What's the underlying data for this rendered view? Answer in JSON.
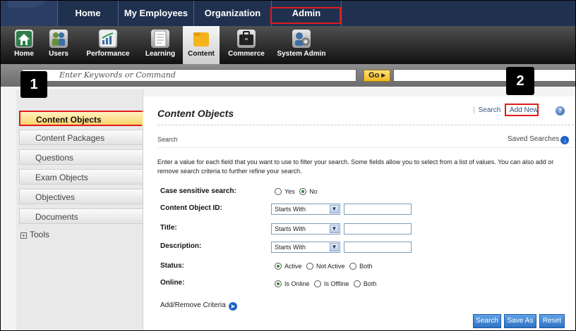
{
  "top_nav": {
    "items": [
      {
        "label": "Home"
      },
      {
        "label": "My Employees"
      },
      {
        "label": "Organization"
      },
      {
        "label": "Admin"
      }
    ]
  },
  "icon_bar": {
    "items": [
      {
        "label": "Home",
        "icon": "house-icon"
      },
      {
        "label": "Users",
        "icon": "users-icon"
      },
      {
        "label": "Performance",
        "icon": "chart-icon"
      },
      {
        "label": "Learning",
        "icon": "document-icon"
      },
      {
        "label": "Content",
        "icon": "folder-icon"
      },
      {
        "label": "Commerce",
        "icon": "briefcase-icon"
      },
      {
        "label": "System Admin",
        "icon": "admin-gear-icon"
      }
    ],
    "active": "Content"
  },
  "search_bar": {
    "placeholder": "Enter Keywords or Command",
    "go_label": "Go ▸"
  },
  "badges": {
    "one": "1",
    "two": "2"
  },
  "sidebar": {
    "items": [
      {
        "label": "Content Objects"
      },
      {
        "label": "Content Packages"
      },
      {
        "label": "Questions"
      },
      {
        "label": "Exam Objects"
      },
      {
        "label": "Objectives"
      },
      {
        "label": "Documents"
      }
    ],
    "tools_label": "Tools",
    "active": "Content Objects"
  },
  "main": {
    "title": "Content Objects",
    "links": {
      "search": "Search",
      "add_new": "Add New"
    },
    "help_label": "?",
    "section_label": "Search",
    "saved_searches": "Saved Searches",
    "intro": "Enter a value for each field that you want to use to filter your search. Some fields allow you to select from a list of values. You can also add or remove search criteria to further refine your search.",
    "fields": {
      "case_sensitive": {
        "label": "Case sensitive search:",
        "options": [
          "Yes",
          "No"
        ],
        "selected": "No"
      },
      "content_object_id": {
        "label": "Content Object ID:",
        "operator": "Starts With",
        "value": ""
      },
      "title": {
        "label": "Title:",
        "operator": "Starts With",
        "value": ""
      },
      "description": {
        "label": "Description:",
        "operator": "Starts With",
        "value": ""
      },
      "status": {
        "label": "Status:",
        "options": [
          "Active",
          "Not Active",
          "Both"
        ],
        "selected": "Active"
      },
      "online": {
        "label": "Online:",
        "options": [
          "Is Online",
          "Is Offline",
          "Both"
        ],
        "selected": "Is Online"
      }
    },
    "add_remove_criteria": "Add/Remove Criteria",
    "buttons": {
      "search": "Search",
      "save_as": "Save As",
      "reset": "Reset"
    }
  },
  "colors": {
    "nav_bg": "#20314f",
    "highlight_red": "#e01b1b",
    "active_tab_yellow": "#fcd36a",
    "button_blue": "#2f73c4"
  }
}
